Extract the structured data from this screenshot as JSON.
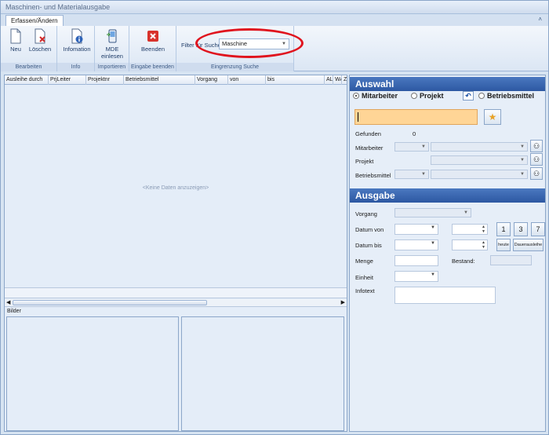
{
  "window": {
    "title": "Maschinen- und Materialausgabe"
  },
  "tabs": [
    {
      "label": "Erfassen/Ändern"
    }
  ],
  "ribbon": {
    "groups": [
      {
        "label": "Bearbeiten",
        "buttons": [
          {
            "label": "Neu",
            "icon": "new-document-icon"
          },
          {
            "label": "Löschen",
            "icon": "delete-document-icon"
          }
        ]
      },
      {
        "label": "Info",
        "buttons": [
          {
            "label": "Infomation",
            "icon": "info-document-icon"
          }
        ]
      },
      {
        "label": "Importieren",
        "buttons": [
          {
            "label": "MDE einlesen",
            "icon": "mobile-device-icon"
          }
        ]
      },
      {
        "label": "Eingabe beenden",
        "buttons": [
          {
            "label": "Beenden",
            "icon": "close-red-icon"
          }
        ]
      },
      {
        "label": "Eingrenzung Suche"
      }
    ],
    "filter": {
      "label": "Filter für Suche:",
      "value": "Maschine"
    }
  },
  "grid": {
    "columns": [
      "Ausleihe durch",
      "PrjLeiter",
      "Projektnr",
      "Betriebsmittel",
      "Vorgang",
      "von",
      "bis",
      "AL",
      "WA",
      "Z"
    ],
    "empty_text": "<Keine Daten anzuzeigen>"
  },
  "bilder_label": "Bilder",
  "auswahl": {
    "title": "Auswahl",
    "radios": [
      {
        "label": "Mitarbeiter",
        "selected": true
      },
      {
        "label": "Projekt",
        "selected": false
      },
      {
        "label": "Betriebsmittel",
        "selected": false
      }
    ],
    "gefunden_label": "Gefunden",
    "gefunden_value": "0",
    "mitarbeiter_label": "Mitarbeiter",
    "projekt_label": "Projekt",
    "betriebsmittel_label": "Betriebsmittel"
  },
  "ausgabe": {
    "title": "Ausgabe",
    "vorgang_label": "Vorgang",
    "datum_von_label": "Datum von",
    "datum_bis_label": "Datum bis",
    "menge_label": "Menge",
    "bestand_label": "Bestand:",
    "einheit_label": "Einheit",
    "infotext_label": "Infotext",
    "quick_days": [
      "1",
      "3",
      "7"
    ],
    "heute_label": "heute",
    "dauer_label": "Dauerausleihe"
  },
  "colors": {
    "accent": "#2d58a2",
    "highlight": "#ffd596",
    "annotation": "#e0141e"
  }
}
